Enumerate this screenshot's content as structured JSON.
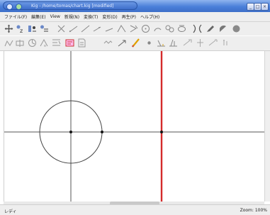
{
  "window": {
    "title": "Kig - /home/tomas/chart.kig [modified]",
    "controls": [
      "_",
      "□",
      "×"
    ]
  },
  "menubar": {
    "items": [
      "ファイル(F)",
      "編集(E)",
      "View",
      "新規(N)",
      "変換(T)",
      "変形(D)",
      "再生(P)",
      "ヘルプ(H)"
    ]
  },
  "toolbar1": {
    "icons": [
      "move-icon",
      "point-icon",
      "point-options-icon",
      "point-label-icon",
      "segment-icon",
      "ray-icon",
      "line-icon",
      "vector-icon",
      "circle-icon",
      "arc-icon",
      "conic-icon",
      "polygon-icon",
      "cubic-icon",
      "locus-icon",
      "ellipse-icon",
      "hyperbola-icon"
    ]
  },
  "toolbar2": {
    "icons": [
      "measure-icon",
      "midpoint-icon",
      "angle-icon",
      "text-icon",
      "macro-icon",
      "script-icon",
      "transform-icon",
      "rotate-icon",
      "pen-icon",
      "dot-icon",
      "perpendicular-icon",
      "angle-measure-icon",
      "translate-icon",
      "reflect-icon",
      "scale-icon"
    ]
  },
  "canvas": {
    "circle": "circle",
    "axes": [
      "x-axis",
      "y-axis"
    ],
    "red_line": "line",
    "accent": "#d42b2b"
  },
  "status": {
    "left": "レディ",
    "right": "Zoom: 100%"
  }
}
